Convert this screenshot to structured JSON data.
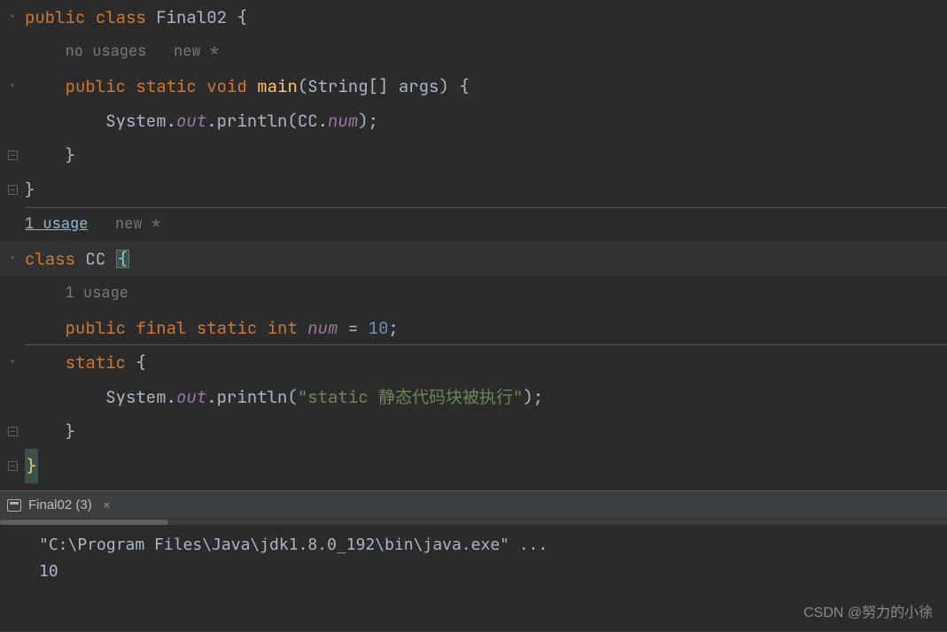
{
  "hints": {
    "no_usages": "no usages",
    "new_star": "new *",
    "one_usage_link": "1 usage",
    "one_usage": "1 usage"
  },
  "code": {
    "l1_public": "public",
    "l1_class": "class",
    "l1_name": "Final02",
    "l1_brace": " {",
    "l3_public": "public",
    "l3_static": "static",
    "l3_void": "void",
    "l3_main": "main",
    "l3_args": "(String[] args) {",
    "l4_sys": "System.",
    "l4_out": "out",
    "l4_println": ".println(CC.",
    "l4_num": "num",
    "l4_end": ");",
    "l5_brace": "}",
    "l6_brace": "}",
    "l8_class": "class",
    "l8_name": "CC",
    "l8_brace": "{",
    "l10_public": "public",
    "l10_final": "final",
    "l10_static": "static",
    "l10_int": "int",
    "l10_num": "num",
    "l10_eq": " = ",
    "l10_val": "10",
    "l10_semi": ";",
    "l11_static": "static",
    "l11_brace": " {",
    "l12_sys": "System.",
    "l12_out": "out",
    "l12_println": ".println(",
    "l12_str": "\"static 静态代码块被执行\"",
    "l12_end": ");",
    "l13_brace": "}",
    "l14_brace": "}"
  },
  "tab": {
    "label": "Final02 (3)"
  },
  "console": {
    "line1": "\"C:\\Program Files\\Java\\jdk1.8.0_192\\bin\\java.exe\" ...",
    "line2": "10"
  },
  "watermark": "CSDN @努力的小徐"
}
